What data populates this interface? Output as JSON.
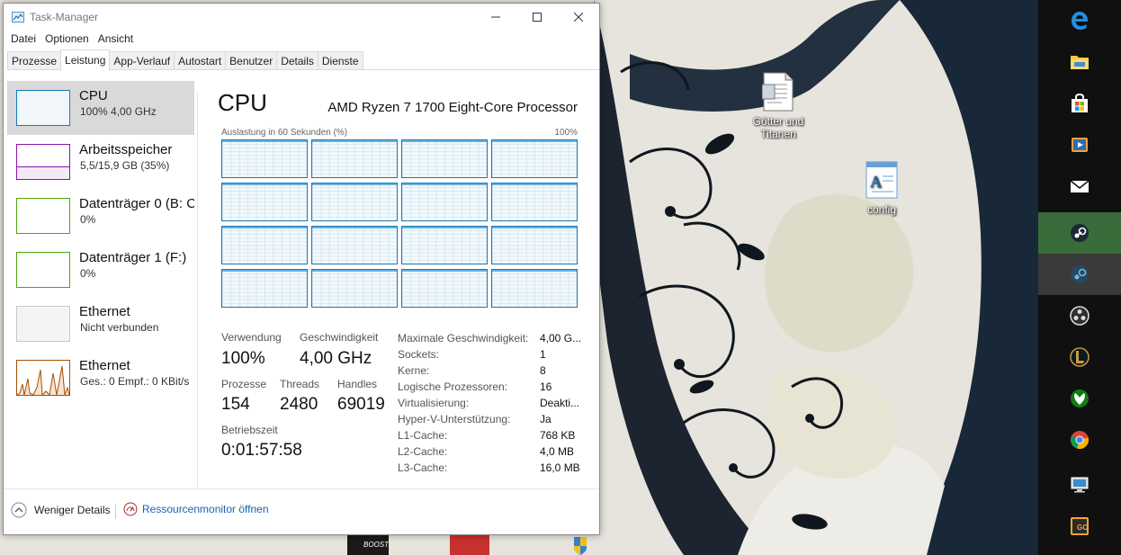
{
  "window": {
    "title": "Task-Manager",
    "menu": [
      "Datei",
      "Optionen",
      "Ansicht"
    ],
    "tabs": [
      "Prozesse",
      "Leistung",
      "App-Verlauf",
      "Autostart",
      "Benutzer",
      "Details",
      "Dienste"
    ],
    "selected_tab": "Leistung"
  },
  "sidebar": {
    "items": [
      {
        "title": "CPU",
        "sub": "100% 4,00 GHz",
        "color": "#117dbb"
      },
      {
        "title": "Arbeitsspeicher",
        "sub": "5,5/15,9 GB (35%)",
        "color": "#8b12ae"
      },
      {
        "title": "Datenträger 0 (B: C",
        "sub": "0%",
        "color": "#4da60c"
      },
      {
        "title": "Datenträger 1 (F:)",
        "sub": "0%",
        "color": "#4da60c"
      },
      {
        "title": "Ethernet",
        "sub": "Nicht verbunden",
        "color": "#a7a7a7"
      },
      {
        "title": "Ethernet",
        "sub": "Ges.: 0  Empf.: 0 KBit/s",
        "color": "#a74f01"
      }
    ],
    "memory_usage_fraction": 0.35
  },
  "cpu": {
    "title": "CPU",
    "processor": "AMD Ryzen 7 1700 Eight-Core Processor",
    "graph_caption": "Auslastung in 60 Sekunden (%)",
    "graph_max": "100%",
    "logical_cores": 16,
    "utilization_fraction": 1.0,
    "stats": {
      "usage_label": "Verwendung",
      "usage": "100%",
      "speed_label": "Geschwindigkeit",
      "speed": "4,00 GHz",
      "processes_label": "Prozesse",
      "processes": "154",
      "threads_label": "Threads",
      "threads": "2480",
      "handles_label": "Handles",
      "handles": "69019",
      "uptime_label": "Betriebszeit",
      "uptime": "0:01:57:58"
    },
    "details": [
      {
        "label": "Maximale Geschwindigkeit:",
        "value": "4,00 G..."
      },
      {
        "label": "Sockets:",
        "value": "1"
      },
      {
        "label": "Kerne:",
        "value": "8"
      },
      {
        "label": "Logische Prozessoren:",
        "value": "16"
      },
      {
        "label": "Virtualisierung:",
        "value": "Deakti..."
      },
      {
        "label": "Hyper-V-Unterstützung:",
        "value": "Ja"
      },
      {
        "label": "L1-Cache:",
        "value": "768 KB"
      },
      {
        "label": "L2-Cache:",
        "value": "4,0 MB"
      },
      {
        "label": "L3-Cache:",
        "value": "16,0 MB"
      }
    ]
  },
  "footer": {
    "fewer_details": "Weniger Details",
    "resource_monitor": "Ressourcenmonitor öffnen"
  },
  "desktop": {
    "icons": [
      {
        "label": "Götter und Titanen",
        "icon": "document-icon"
      },
      {
        "label": "config",
        "icon": "text-file-icon"
      }
    ],
    "bottom_overlay_text": "BOOST"
  },
  "taskbar": {
    "apps": [
      "edge-icon",
      "file-explorer-icon",
      "store-icon",
      "media-player-icon",
      "mail-icon",
      "steam-icon",
      "steam-running-icon",
      "obs-icon",
      "league-icon",
      "xbox-icon",
      "chrome-icon",
      "remote-desktop-icon",
      "csgo-icon"
    ]
  },
  "colors": {
    "cpu_graph_border": "#1f74b2",
    "cpu_graph_line": "#64b5e6",
    "selected_item_bg": "#d9d9d9",
    "taskbar_bg": "#101010",
    "link": "#1a5fb4"
  }
}
